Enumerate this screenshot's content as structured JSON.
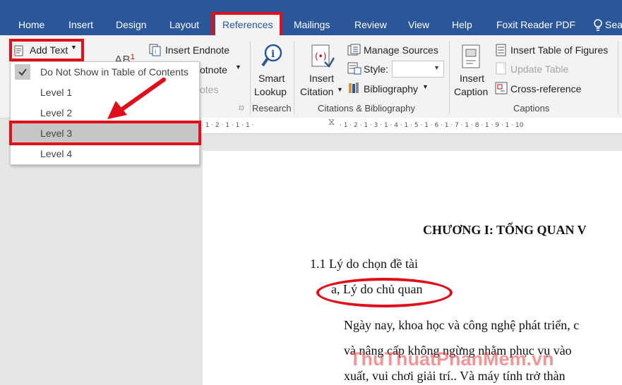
{
  "tabs": [
    {
      "label": "Home"
    },
    {
      "label": "Insert"
    },
    {
      "label": "Design"
    },
    {
      "label": "Layout"
    },
    {
      "label": "References",
      "active": true
    },
    {
      "label": "Mailings"
    },
    {
      "label": "Review"
    },
    {
      "label": "View"
    },
    {
      "label": "Help"
    },
    {
      "label": "Foxit Reader PDF"
    },
    {
      "label": "Sea"
    }
  ],
  "ribbon": {
    "add_text": "Add Text",
    "insert_endnote": "Insert Endnote",
    "next_footnote_partial": "otnote",
    "show_notes_partial": "otes",
    "footnote_icon_text": "AB",
    "footnote_superscript": "1",
    "smart_lookup": [
      "Smart",
      "Lookup"
    ],
    "research_group": "Research",
    "insert_citation": [
      "Insert",
      "Citation"
    ],
    "manage_sources": "Manage Sources",
    "style_label": "Style:",
    "bibliography": "Bibliography",
    "citations_group": "Citations & Bibliography",
    "insert_caption": [
      "Insert",
      "Caption"
    ],
    "insert_table_of_figures": "Insert Table of Figures",
    "update_table": "Update Table",
    "cross_reference": "Cross-reference",
    "captions_group": "Captions"
  },
  "dropdown": {
    "items": [
      {
        "label": "Do Not Show in Table of Contents",
        "checked": true
      },
      {
        "label": "Level 1"
      },
      {
        "label": "Level 2"
      },
      {
        "label": "Level 3",
        "highlighted": true
      },
      {
        "label": "Level 4"
      }
    ]
  },
  "ruler": {
    "left": "· 1 · 2 · 1 · 1 · 1 ·",
    "right": "· 1 · 2 · 1 · 3 · 1 · 4 · 1 · 5 · 1 · 6 · 1 · 7 · 1 · 8 · 1 · 9 · 1 · 10"
  },
  "document": {
    "chapter_title": "CHƯƠNG I: TỔNG QUAN V",
    "heading_1_1": "1.1 Lý do chọn đề tài",
    "subheading_a": "a, Lý do chủ quan",
    "para_line_1": "Ngày nay, khoa học và công nghệ phát triển, c",
    "para_line_2": "và nâng cấp không ngừng nhằm phục vụ vào",
    "para_line_3": "xuất, vui chơi giải trí.. Và máy tính trở thàn"
  },
  "watermark": "ThuThuatPhanMem.vn",
  "colors": {
    "accent": "#2b579a",
    "annotation_red": "#e0101a",
    "menu_highlight": "#c6c6c6"
  }
}
